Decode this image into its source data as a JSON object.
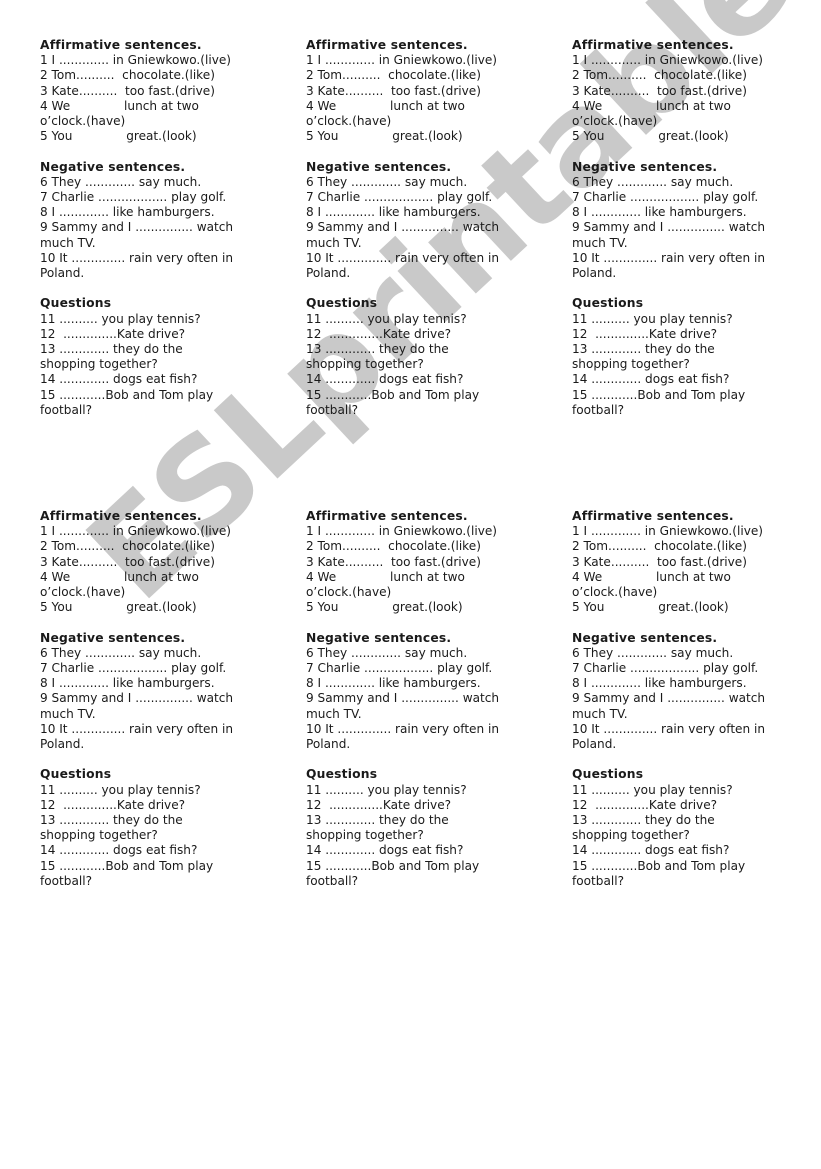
{
  "watermark": "ESLprintables.com",
  "card": {
    "affirmative": {
      "heading": "Affirmative sentences.",
      "lines": [
        "1 I ............. in Gniewkowo.(live)",
        "2 Tom..........  chocolate.(like)",
        "3 Kate..........  too fast.(drive)",
        "4 We              lunch at two",
        "o’clock.(have)",
        "5 You              great.(look)"
      ]
    },
    "negative": {
      "heading": "Negative sentences.",
      "lines": [
        "6 They ............. say much.",
        "7 Charlie .................. play golf.",
        "8 I ............. like hamburgers.",
        "9 Sammy and I ............... watch",
        "much TV.",
        "10 It .............. rain very often in",
        "Poland."
      ]
    },
    "questions": {
      "heading": "Questions",
      "lines": [
        "11 .......... you play tennis?",
        "12  ..............Kate drive?",
        "13 ............. they do the",
        "shopping together?",
        "14 ............. dogs eat fish?",
        "15 ............Bob and Tom play",
        "football?"
      ]
    }
  },
  "cards": [
    {
      "id": "top-left"
    },
    {
      "id": "top-middle"
    },
    {
      "id": "top-right"
    },
    {
      "id": "bottom-left"
    },
    {
      "id": "bottom-middle"
    },
    {
      "id": "bottom-right"
    }
  ]
}
